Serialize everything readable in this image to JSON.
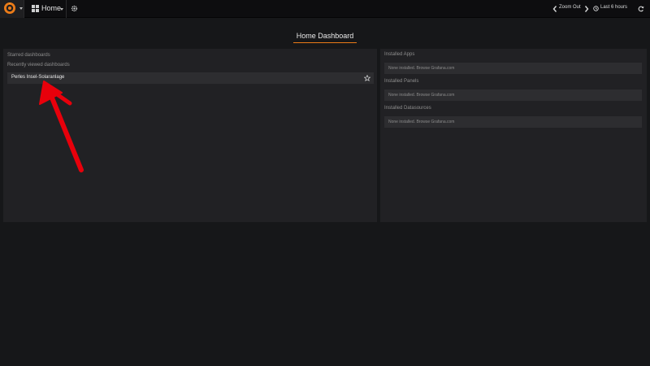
{
  "topbar": {
    "home_label": "Home",
    "zoom_out_label": "Zoom Out",
    "time_range_label": "Last 6 hours"
  },
  "page": {
    "title": "Home Dashboard"
  },
  "left_panel": {
    "starred_label": "Starred dashboards",
    "recent_label": "Recently viewed dashboards",
    "recent_items": [
      "Perles Insel-Solaranlage"
    ]
  },
  "right_panel": {
    "sections": [
      {
        "label": "Installed Apps",
        "none_text": "None installed.",
        "link_text": "Browse Grafana.com"
      },
      {
        "label": "Installed Panels",
        "none_text": "None installed.",
        "link_text": "Browse Grafana.com"
      },
      {
        "label": "Installed Datasources",
        "none_text": "None installed.",
        "link_text": "Browse Grafana.com"
      }
    ]
  },
  "colors": {
    "background": "#161719",
    "panel": "#212124",
    "row": "#2d2d30",
    "title_underline": "#eb7b18",
    "logo": "#eb7b18",
    "annotation_arrow": "#e8000b"
  },
  "icons": {
    "logo": "grafana-logo-icon",
    "grid": "dashboard-grid-icon",
    "settings": "gear-icon",
    "zoom_prev": "chevron-left-icon",
    "zoom_next": "chevron-right-icon",
    "clock": "clock-icon",
    "refresh": "refresh-icon",
    "star": "star-icon"
  }
}
